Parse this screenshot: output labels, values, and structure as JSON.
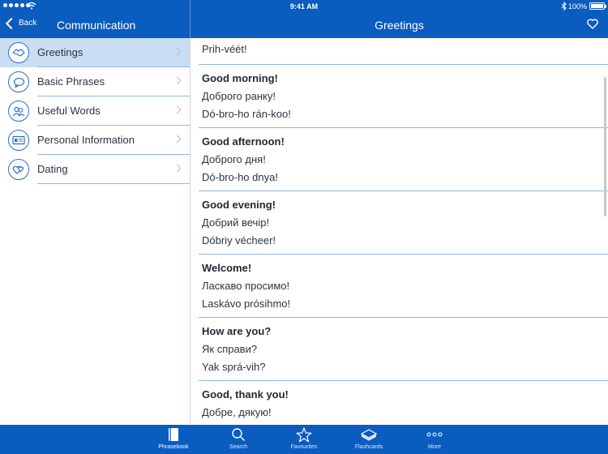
{
  "status": {
    "time": "9:41 AM",
    "battery": "100%"
  },
  "nav": {
    "back_label": "Back",
    "left_title": "Communication",
    "right_title": "Greetings"
  },
  "sidebar": {
    "items": [
      {
        "label": "Greetings",
        "icon": "handshake-icon",
        "selected": true
      },
      {
        "label": "Basic Phrases",
        "icon": "speech-bubble-icon",
        "selected": false
      },
      {
        "label": "Useful Words",
        "icon": "people-icon",
        "selected": false
      },
      {
        "label": "Personal Information",
        "icon": "id-card-icon",
        "selected": false
      },
      {
        "label": "Dating",
        "icon": "hearts-icon",
        "selected": false
      }
    ]
  },
  "phrases": [
    {
      "en": "",
      "ua": "",
      "tr": "Prih-véét!"
    },
    {
      "en": "Good morning!",
      "ua": "Доброго ранку!",
      "tr": "Dó-bro-ho rán-koo!"
    },
    {
      "en": "Good afternoon!",
      "ua": "Доброго дня!",
      "tr": "Dó-bro-ho dnya!"
    },
    {
      "en": "Good evening!",
      "ua": "Добрий вечір!",
      "tr": "Dóbriy vécheer!"
    },
    {
      "en": "Welcome!",
      "ua": "Ласкаво просимо!",
      "tr": "Laskávo prósihmo!"
    },
    {
      "en": "How are you?",
      "ua": "Як справи?",
      "tr": "Yak sprá-vih?"
    },
    {
      "en": "Good, thank you!",
      "ua": "Добре, дякую!",
      "tr": ""
    }
  ],
  "tabs": [
    {
      "label": "Phrasebook",
      "icon": "book-icon",
      "active": true
    },
    {
      "label": "Search",
      "icon": "search-icon",
      "active": false
    },
    {
      "label": "Favourites",
      "icon": "star-icon",
      "active": false
    },
    {
      "label": "Flashcards",
      "icon": "cards-icon",
      "active": false
    },
    {
      "label": "More",
      "icon": "more-dots-icon",
      "active": false
    }
  ],
  "colors": {
    "brand": "#0b5cbf",
    "selected_row": "#c9def3",
    "separator": "#8fb6e3"
  }
}
